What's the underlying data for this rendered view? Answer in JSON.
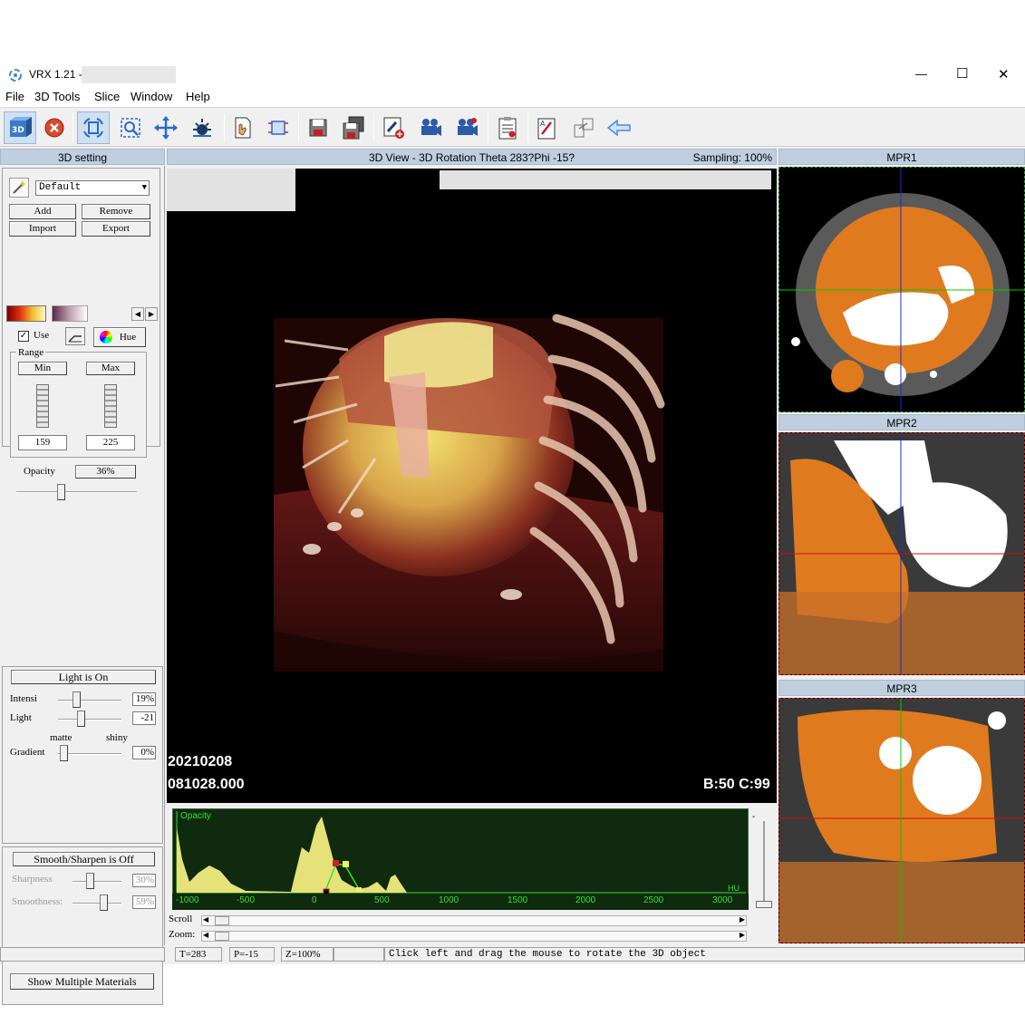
{
  "window": {
    "title": "VRX 1.21 -",
    "controls": {
      "minimize": "—",
      "maximize": "☐",
      "close": "✕"
    }
  },
  "menu": [
    "File",
    "3D Tools",
    "Slice",
    "Window",
    "Help"
  ],
  "toolbar": {
    "icons": [
      "3d-view-icon",
      "stop-icon",
      "rotate-icon",
      "zoom-icon",
      "move-icon",
      "brightness-icon",
      "tools-hand-icon",
      "crop-icon",
      "save-icon",
      "save-all-icon",
      "add-marker-icon",
      "camera-icon",
      "video-icon",
      "report-icon",
      "edit-icon",
      "export-icon",
      "back-arrow-icon"
    ]
  },
  "left_panel": {
    "header": "3D setting",
    "preset": "Default",
    "add_label": "Add",
    "remove_label": "Remove",
    "import_label": "Import",
    "export_label": "Export",
    "use_label": "Use",
    "use_checked": true,
    "hue_label": "Hue",
    "range_label": "Range",
    "min_label": "Min",
    "max_label": "Max",
    "min_value": "159",
    "max_value": "225",
    "opacity_label": "Opacity",
    "opacity_value": "36%",
    "opacity_level": 0.36
  },
  "light_panel": {
    "toggle_label": "Light is On",
    "intensity_label": "Intensi",
    "intensity_value": "19%",
    "light_label": "Light",
    "light_value": "-21",
    "matte_label": "matte",
    "shiny_label": "shiny",
    "gradient_label": "Gradient",
    "gradient_value": "0%"
  },
  "smooth_panel": {
    "toggle_label": "Smooth/Sharpen is Off",
    "sharpness_label": "Sharpness",
    "sharpness_value": "30%",
    "smoothness_label": "Smoothness:",
    "smoothness_value": "59%"
  },
  "materials_button": "Show Multiple Materials",
  "view3d": {
    "header": "3D View - 3D Rotation Theta 283?Phi -15?",
    "sampling": "Sampling: 100%",
    "date": "20210208",
    "time": "081028.000",
    "bc": "B:50 C:99"
  },
  "histogram": {
    "opacity_label": "Opacity",
    "hu_label": "HU",
    "ticks": [
      "-1000",
      "-500",
      "0",
      "500",
      "1000",
      "1500",
      "2000",
      "2500",
      "3000"
    ],
    "scroll_label": "Scroll",
    "zoom_label": "Zoom:"
  },
  "mpr": {
    "mpr1": "MPR1",
    "mpr2": "MPR2",
    "mpr3": "MPR3"
  },
  "status": {
    "theta": "T=283",
    "phi": "P=-15",
    "zoom": "Z=100%",
    "hint": "Click left and drag the mouse to rotate the 3D object"
  },
  "colors": {
    "panel_head": "#bfcfe0",
    "histogram_bg": "#0f2a0f",
    "histogram_fill": "#e6e27a",
    "histogram_axis": "#35e035",
    "mpr_tissue": "#e07a1e",
    "crosshair_green": "#00cc00",
    "crosshair_blue": "#1a2bd6",
    "crosshair_red": "#d01010"
  }
}
